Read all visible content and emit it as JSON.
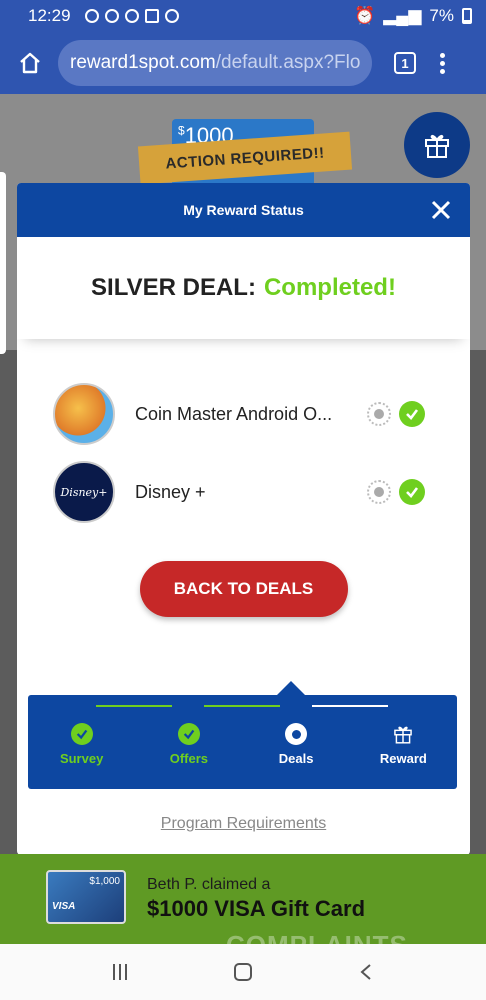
{
  "status_bar": {
    "time": "12:29",
    "battery": "7%"
  },
  "browser": {
    "url_host": "reward1spot.com",
    "url_path": "/default.aspx?Flo",
    "tab_count": "1"
  },
  "background": {
    "card_amount": "1000",
    "card_currency": "$",
    "action_label": "ACTION REQUIRED!!"
  },
  "modal": {
    "title": "My Reward Status",
    "status_prefix": "SILVER DEAL:",
    "status_value": "Completed!",
    "deals": [
      {
        "name": "Coin Master Android O...",
        "logo": "coin-master-logo"
      },
      {
        "name": "Disney +",
        "logo": "disney-plus-logo",
        "logo_text": "Disney+"
      }
    ],
    "back_button": "BACK TO DEALS",
    "steps": [
      {
        "label": "Survey",
        "state": "done"
      },
      {
        "label": "Offers",
        "state": "done"
      },
      {
        "label": "Deals",
        "state": "current"
      },
      {
        "label": "Reward",
        "state": "upcoming"
      }
    ],
    "requirements_link": "Program Requirements"
  },
  "promo": {
    "line1": "Beth P. claimed a",
    "line2": "$1000 VISA Gift Card",
    "card_label": "VISA",
    "card_amount": "$1,000",
    "watermark": "COMPLAINTS"
  },
  "colors": {
    "accent_blue": "#0d47a1",
    "success_green": "#6fcf1f",
    "danger_red": "#c62828"
  }
}
